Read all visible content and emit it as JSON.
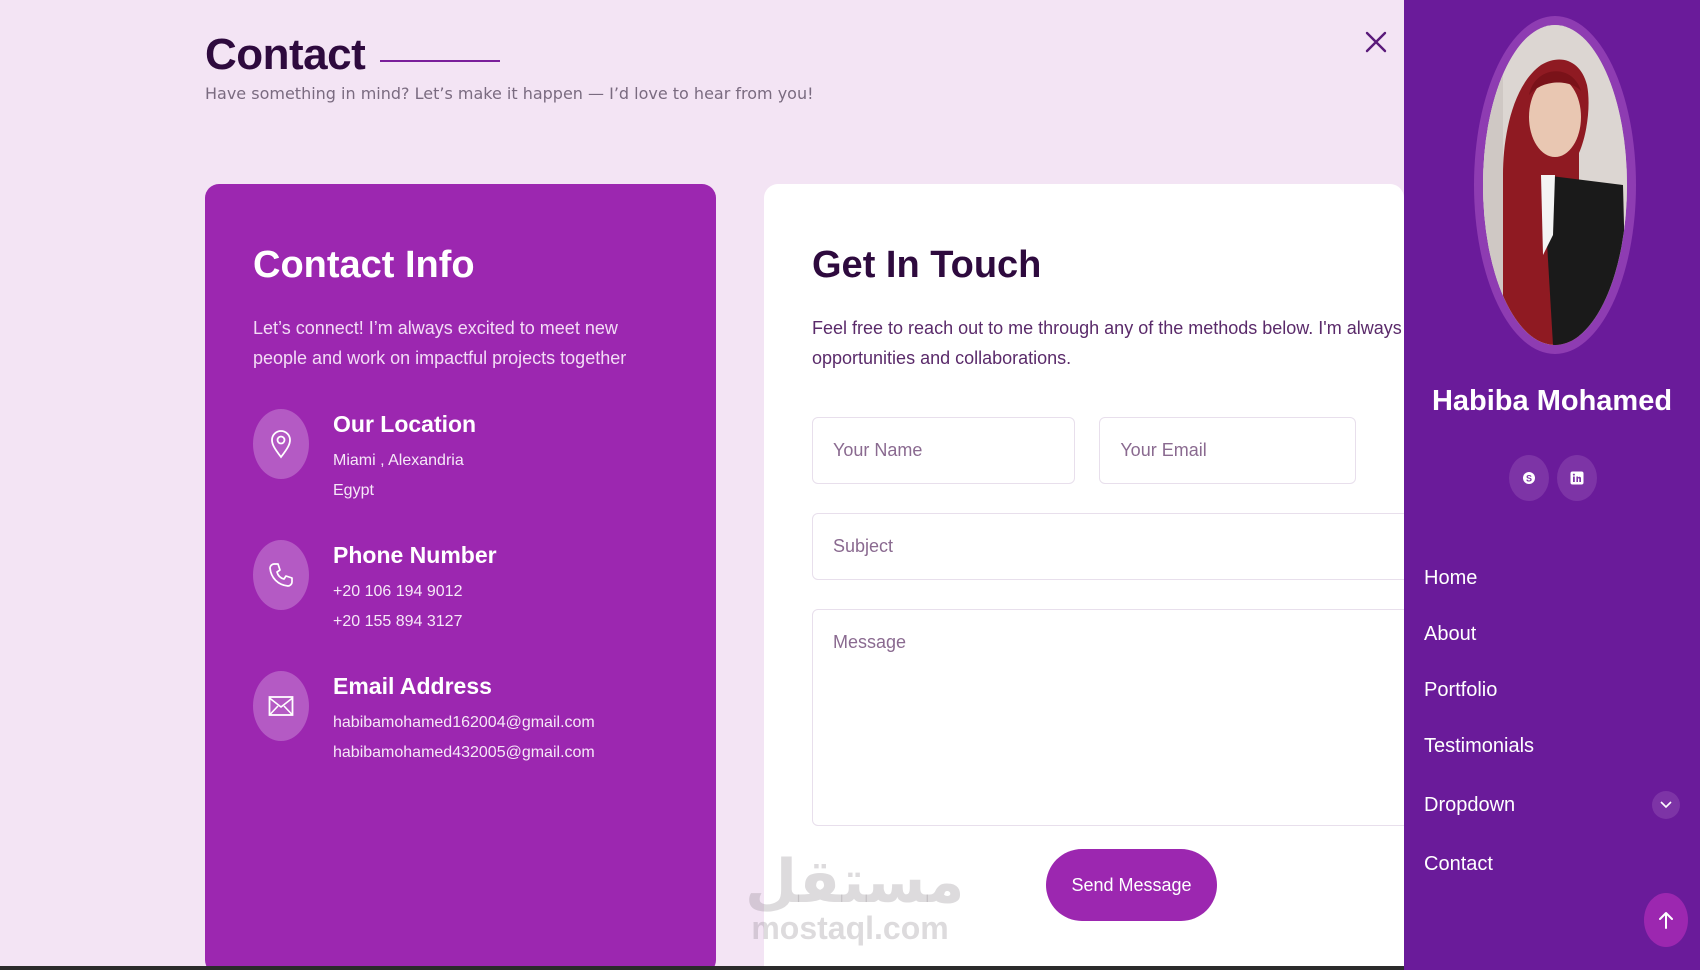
{
  "header": {
    "title": "Contact",
    "subtitle": "Have something in mind? Let’s make it happen — I’d love to hear from you!"
  },
  "contact_info": {
    "title": "Contact Info",
    "description": "Let’s connect! I’m always excited to meet new people and work on impactful projects together",
    "items": [
      {
        "icon": "map-pin-icon",
        "heading": "Our Location",
        "lines": [
          "Miami , Alexandria",
          "Egypt"
        ]
      },
      {
        "icon": "phone-icon",
        "heading": "Phone Number",
        "lines": [
          "+20 106 194 9012",
          "+20 155 894 3127"
        ]
      },
      {
        "icon": "mail-icon",
        "heading": "Email Address",
        "lines": [
          "habibamohamed162004@gmail.com",
          "habibamohamed432005@gmail.com"
        ]
      }
    ]
  },
  "form": {
    "title": "Get In Touch",
    "description_line1": "Feel free to reach out to me through any of the methods below. I'm always open to n",
    "description_line2": "opportunities and collaborations.",
    "name_placeholder": "Your Name",
    "email_placeholder": "Your Email",
    "subject_placeholder": "Subject",
    "message_placeholder": "Message",
    "send_label": "Send Message"
  },
  "watermark": {
    "arabic": "مستقل",
    "latin": "mostaql.com"
  },
  "sidebar": {
    "profile_name": "Habiba Mohamed",
    "socials": [
      "skype-icon",
      "linkedin-icon"
    ],
    "nav": [
      "Home",
      "About",
      "Portfolio",
      "Testimonials",
      "Dropdown",
      "Contact"
    ]
  },
  "colors": {
    "accent": "#9c27b0",
    "sidebar": "#6a1b9a",
    "background": "#f3e4f4"
  }
}
